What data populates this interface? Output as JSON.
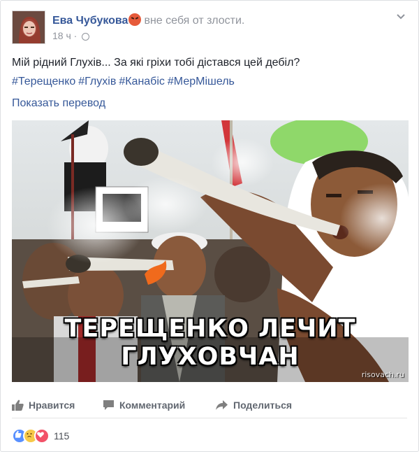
{
  "post": {
    "author": "Ева Чубукова",
    "feeling": "вне себя от злости.",
    "time": "18 ч",
    "text": "Мій рідний Глухів... За які гріхи тобі дістався цей дебіл?",
    "hashtags": [
      "#Терещенко",
      "#Глухів",
      "#Канабіс",
      "#МерМішель"
    ],
    "translate_link": "Показать перевод",
    "image": {
      "caption": "ТЕРЕЩЕНКО ЛЕЧИТ ГЛУХОВЧАН",
      "watermark": "risovach.ru"
    }
  },
  "actions": {
    "like": "Нравится",
    "comment": "Комментарий",
    "share": "Поделиться"
  },
  "reactions": {
    "count": "115",
    "types": [
      "like-icon",
      "sad-icon",
      "love-icon"
    ]
  },
  "colors": {
    "link": "#365899",
    "meta": "#90949c",
    "action": "#616770"
  }
}
